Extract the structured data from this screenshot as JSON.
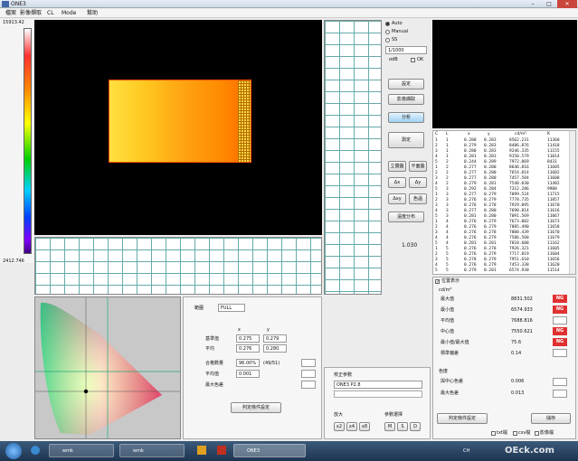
{
  "window": {
    "title": "ONE3"
  },
  "menu": [
    "檔案",
    "影像擷取",
    "CL",
    "Mode",
    "幫助"
  ],
  "colorbar": {
    "max_label": "15913.42",
    "min_label": "2412.746"
  },
  "mode": {
    "auto": "Auto",
    "manual": "Manual",
    "ss": "SS",
    "exposure_value": "1/1000",
    "odb_label": "odB",
    "ok_label": "OK"
  },
  "buttons": {
    "settings": "設定",
    "capture": "影像擷取",
    "analyze": "分析",
    "measure": "測定",
    "btn_3d": "立體圖",
    "btn_plane": "平面圖",
    "btn_dx": "Δx",
    "btn_dy": "Δy",
    "btn_dxy": "Δxy",
    "btn_color": "色溫",
    "btn_dist": "遠度分布"
  },
  "readout": "1.030",
  "list": {
    "headers": [
      "C",
      "L",
      "x",
      "y",
      "cd/m²",
      "K"
    ],
    "rows": [
      [
        "1",
        "1",
        "0.280",
        "0.283",
        "8562.231",
        "11368"
      ],
      [
        "2",
        "1",
        "0.279",
        "0.283",
        "8486.876",
        "11418"
      ],
      [
        "3",
        "1",
        "0.280",
        "0.283",
        "9246.335",
        "11155"
      ],
      [
        "4",
        "1",
        "0.281",
        "0.283",
        "9150.579",
        "11014"
      ],
      [
        "5",
        "2",
        "0.244",
        "0.289",
        "7972.869",
        "8431"
      ],
      [
        "1",
        "2",
        "0.277",
        "0.280",
        "8646.816",
        "11605"
      ],
      [
        "2",
        "2",
        "0.277",
        "0.280",
        "7654.814",
        "11682"
      ],
      [
        "3",
        "2",
        "0.277",
        "0.280",
        "7457.584",
        "11608"
      ],
      [
        "4",
        "2",
        "0.279",
        "0.281",
        "7548.830",
        "11482"
      ],
      [
        "5",
        "3",
        "0.292",
        "0.284",
        "7312.286",
        "9908"
      ],
      [
        "1",
        "3",
        "0.277",
        "0.279",
        "7099.524",
        "11715"
      ],
      [
        "2",
        "3",
        "0.276",
        "0.279",
        "7778.735",
        "11857"
      ],
      [
        "3",
        "3",
        "0.276",
        "0.278",
        "7929.095",
        "11670"
      ],
      [
        "4",
        "3",
        "0.277",
        "0.280",
        "7690.814",
        "11616"
      ],
      [
        "5",
        "3",
        "0.281",
        "0.280",
        "7091.569",
        "11067"
      ],
      [
        "1",
        "4",
        "0.276",
        "0.279",
        "7673.082",
        "11673"
      ],
      [
        "2",
        "4",
        "0.276",
        "0.279",
        "7885.490",
        "11658"
      ],
      [
        "3",
        "4",
        "0.276",
        "0.278",
        "7808.439",
        "11670"
      ],
      [
        "4",
        "4",
        "0.276",
        "0.279",
        "7586.568",
        "11679"
      ],
      [
        "5",
        "4",
        "0.281",
        "0.281",
        "7818.608",
        "11162"
      ],
      [
        "1",
        "5",
        "0.276",
        "0.278",
        "7926.321",
        "11605"
      ],
      [
        "2",
        "5",
        "0.276",
        "0.279",
        "7717.819",
        "11604"
      ],
      [
        "3",
        "5",
        "0.278",
        "0.279",
        "7951.610",
        "11656"
      ],
      [
        "4",
        "5",
        "0.276",
        "0.279",
        "7453.338",
        "11620"
      ],
      [
        "5",
        "5",
        "0.279",
        "0.281",
        "6574.930",
        "11514"
      ]
    ]
  },
  "results": {
    "position_display": "位置表示",
    "unit": "cd/m²",
    "items": [
      {
        "label": "最大值",
        "value": "8831.502",
        "flag": "NG"
      },
      {
        "label": "最小值",
        "value": "6574.933",
        "flag": "NG"
      },
      {
        "label": "平均值",
        "value": "7688.816",
        "flag": ""
      },
      {
        "label": "中心值",
        "value": "7550.621",
        "flag": "NG"
      },
      {
        "label": "最小值/最大值",
        "value": "75.6",
        "flag": "NG"
      },
      {
        "label": "標準偏差",
        "value": "0.14",
        "flag": ""
      }
    ],
    "color_title": "色度",
    "color_items": [
      {
        "label": "與中心色差",
        "value": "0.006"
      },
      {
        "label": "最大色差",
        "value": "0.013"
      }
    ],
    "criteria_btn": "判定條件設定",
    "save_btn": "儲存",
    "checks": [
      "txt檔",
      "csv檔",
      "影像檔"
    ]
  },
  "analysis": {
    "range_label": "範圍",
    "range_value": "FULL",
    "col_x": "x",
    "col_y": "y",
    "base_label": "基準值",
    "base_x": "0.275",
    "base_y": "0.279",
    "avg_label": "平均",
    "avg_x": "0.276",
    "avg_y": "0.280",
    "pass_label": "合格數量",
    "pass_value": "96.00%",
    "pass_unit": "(49/51)",
    "uni_label": "平均值",
    "uni_value": "0.001",
    "maxdiff_label": "最大色差",
    "criteria_btn": "判定條件設定"
  },
  "calib": {
    "title": "校正參數",
    "value": "ONE3 P2.8",
    "zoom_title": "放大",
    "zoom_opts": [
      "x2",
      "x4",
      "x8"
    ],
    "ref_title": "參數選擇",
    "ref_opts": [
      "M",
      "S",
      "D"
    ]
  },
  "taskbar": {
    "items": [
      "wmk",
      "wmk",
      "ONE3"
    ],
    "lang": "CH",
    "watermark": "OEck.com"
  }
}
